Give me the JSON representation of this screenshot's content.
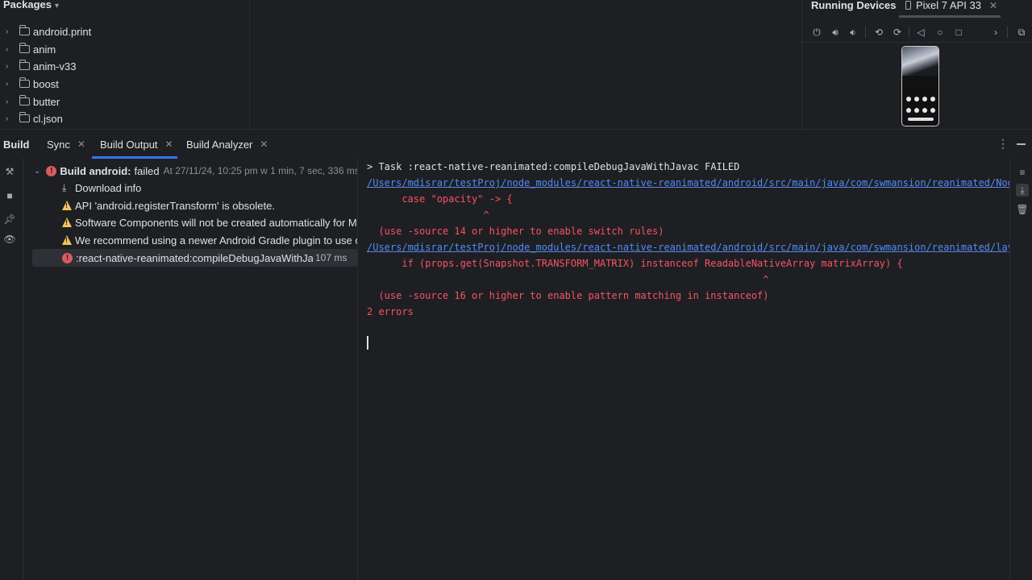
{
  "packages": {
    "title": "Packages",
    "items": [
      "android.print",
      "anim",
      "anim-v33",
      "boost",
      "butter",
      "cl.json"
    ]
  },
  "devices": {
    "title": "Running Devices",
    "tab_label": "Pixel 7 API 33"
  },
  "build_tabs": {
    "build": "Build",
    "sync": "Sync",
    "output": "Build Output",
    "analyzer": "Build Analyzer"
  },
  "tree": {
    "root_label": "Build android:",
    "root_status": "failed",
    "root_meta": "At 27/11/24, 10:25 pm w 1 min, 7 sec, 336 ms",
    "download": "Download info",
    "warnings": [
      "API 'android.registerTransform' is obsolete.",
      "Software Components will not be created automatically for Maven",
      "We recommend using a newer Android Gradle plugin to use compileSdk"
    ],
    "error_task": ":react-native-reanimated:compileDebugJavaWithJavac",
    "error_time": "107 ms"
  },
  "console": {
    "lines": [
      "> Task :react-native-reanimated:compileDebugJavaWithJavac FAILED",
      "/Users/mdisrar/testProj/node_modules/react-native-reanimated/android/src/main/java/com/swmansion/reanimated/NodesManager.java",
      "      case \"opacity\" -> {",
      "                    ^",
      "  (use -source 14 or higher to enable switch rules)",
      "/Users/mdisrar/testProj/node_modules/react-native-reanimated/android/src/main/java/com/swmansion/reanimated/layoutReanimation",
      "      if (props.get(Snapshot.TRANSFORM_MATRIX) instanceof ReadableNativeArray matrixArray) {",
      "                                                                    ^",
      "  (use -source 16 or higher to enable pattern matching in instanceof)",
      "2 errors"
    ]
  },
  "colors": {
    "accent": "#3574f0",
    "error": "#f75464",
    "link": "#548af7",
    "warning": "#f2c55c"
  }
}
